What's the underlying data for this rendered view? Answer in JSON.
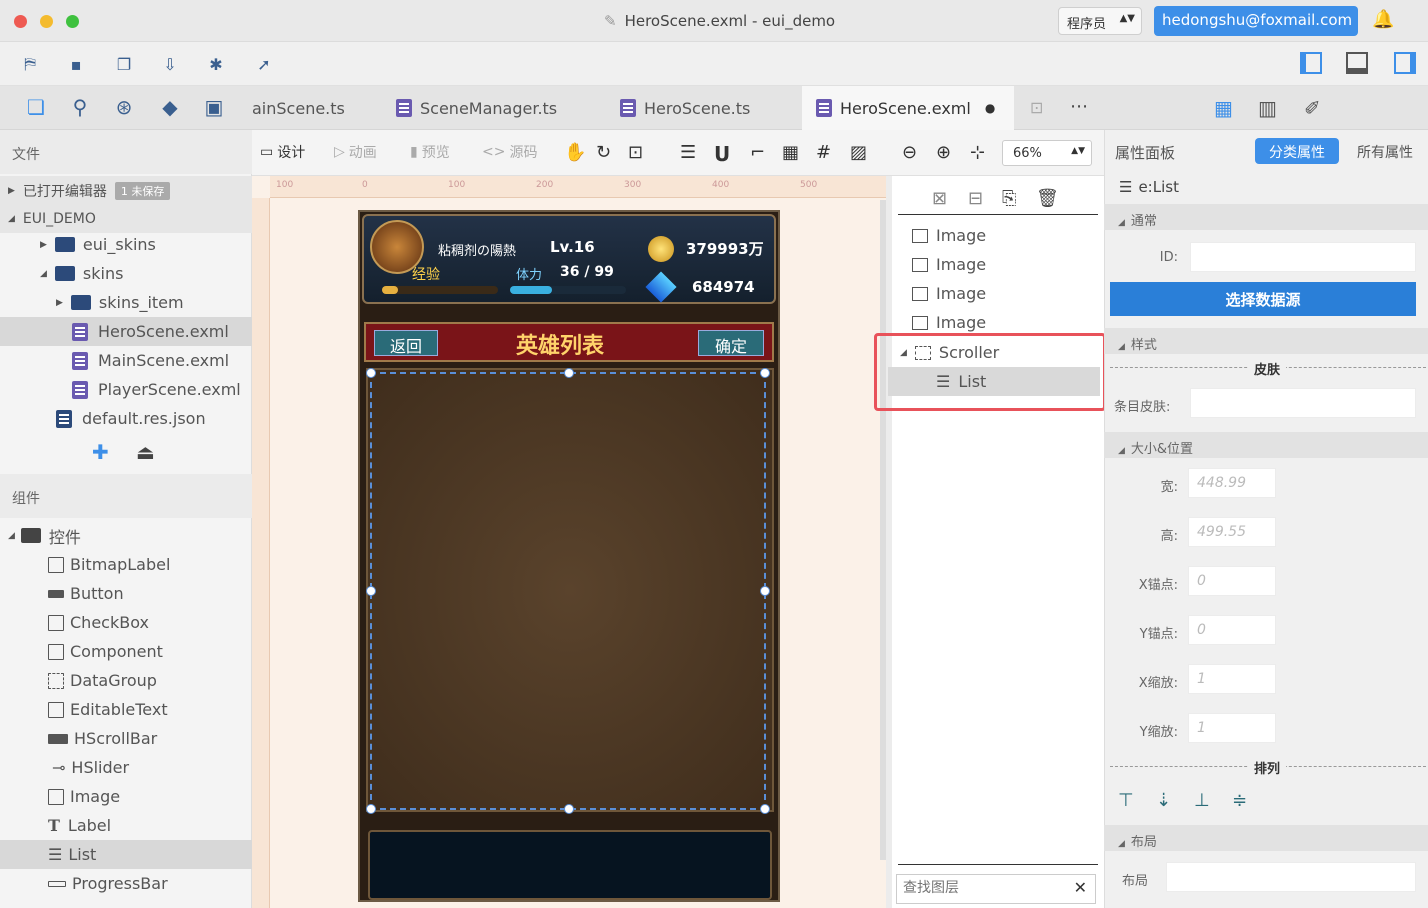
{
  "window": {
    "title": "HeroScene.exml - eui_demo",
    "role": "程序员",
    "account": "hedongshu@foxmail.com"
  },
  "tabs": [
    {
      "label": "ainScene.ts"
    },
    {
      "label": "SceneManager.ts"
    },
    {
      "label": "HeroScene.ts"
    },
    {
      "label": "HeroScene.exml"
    }
  ],
  "left": {
    "files_header": "文件",
    "open_editors": "已打开编辑器",
    "unsaved_badge": "1 未保存",
    "project": "EUI_DEMO",
    "tree": [
      {
        "label": "eui_skins",
        "type": "folder"
      },
      {
        "label": "skins",
        "type": "folder-open"
      },
      {
        "label": "skins_item",
        "type": "folder"
      },
      {
        "label": "HeroScene.exml",
        "type": "file"
      },
      {
        "label": "MainScene.exml",
        "type": "file"
      },
      {
        "label": "PlayerScene.exml",
        "type": "file"
      },
      {
        "label": "default.res.json",
        "type": "json"
      }
    ],
    "components_header": "组件",
    "controls_label": "控件",
    "components": [
      "BitmapLabel",
      "Button",
      "CheckBox",
      "Component",
      "DataGroup",
      "EditableText",
      "HScrollBar",
      "HSlider",
      "Image",
      "Label",
      "List",
      "ProgressBar"
    ]
  },
  "design_toolbar": {
    "design": "设计",
    "anim": "动画",
    "preview": "预览",
    "source": "源码",
    "zoom": "66%"
  },
  "ruler": [
    "100",
    "0",
    "100",
    "200",
    "300",
    "400",
    "500"
  ],
  "game": {
    "player_name": "粘稠剂の陽熱",
    "level": "Lv.16",
    "exp_label": "经验",
    "stamina_label": "体力",
    "stamina": "36 / 99",
    "gold": "379993万",
    "gems": "684974",
    "back": "返回",
    "title": "英雄列表",
    "confirm": "确定"
  },
  "layers": {
    "rows": [
      "Image",
      "Image",
      "Image",
      "Image",
      "Scroller",
      "List"
    ],
    "search_placeholder": "查找图层"
  },
  "props": {
    "panel_title": "属性面板",
    "tab_classified": "分类属性",
    "tab_all": "所有属性",
    "element": "e:List",
    "common": "通常",
    "id_label": "ID:",
    "datasource_btn": "选择数据源",
    "style": "样式",
    "skin_sep": "皮肤",
    "item_skin": "条目皮肤:",
    "size_pos": "大小&位置",
    "width_label": "宽:",
    "width": "448.99",
    "height_label": "高:",
    "height": "499.55",
    "xanchor_label": "X锚点:",
    "xanchor": "0",
    "yanchor_label": "Y锚点:",
    "yanchor": "0",
    "xscale_label": "X缩放:",
    "xscale": "1",
    "yscale_label": "Y缩放:",
    "yscale": "1",
    "arrange_sep": "排列",
    "layout": "布局",
    "layout_label": "布局"
  },
  "colors": {
    "accent": "#3d8fe8",
    "selection": "#e8525a",
    "brand_red": "#b0191f"
  }
}
